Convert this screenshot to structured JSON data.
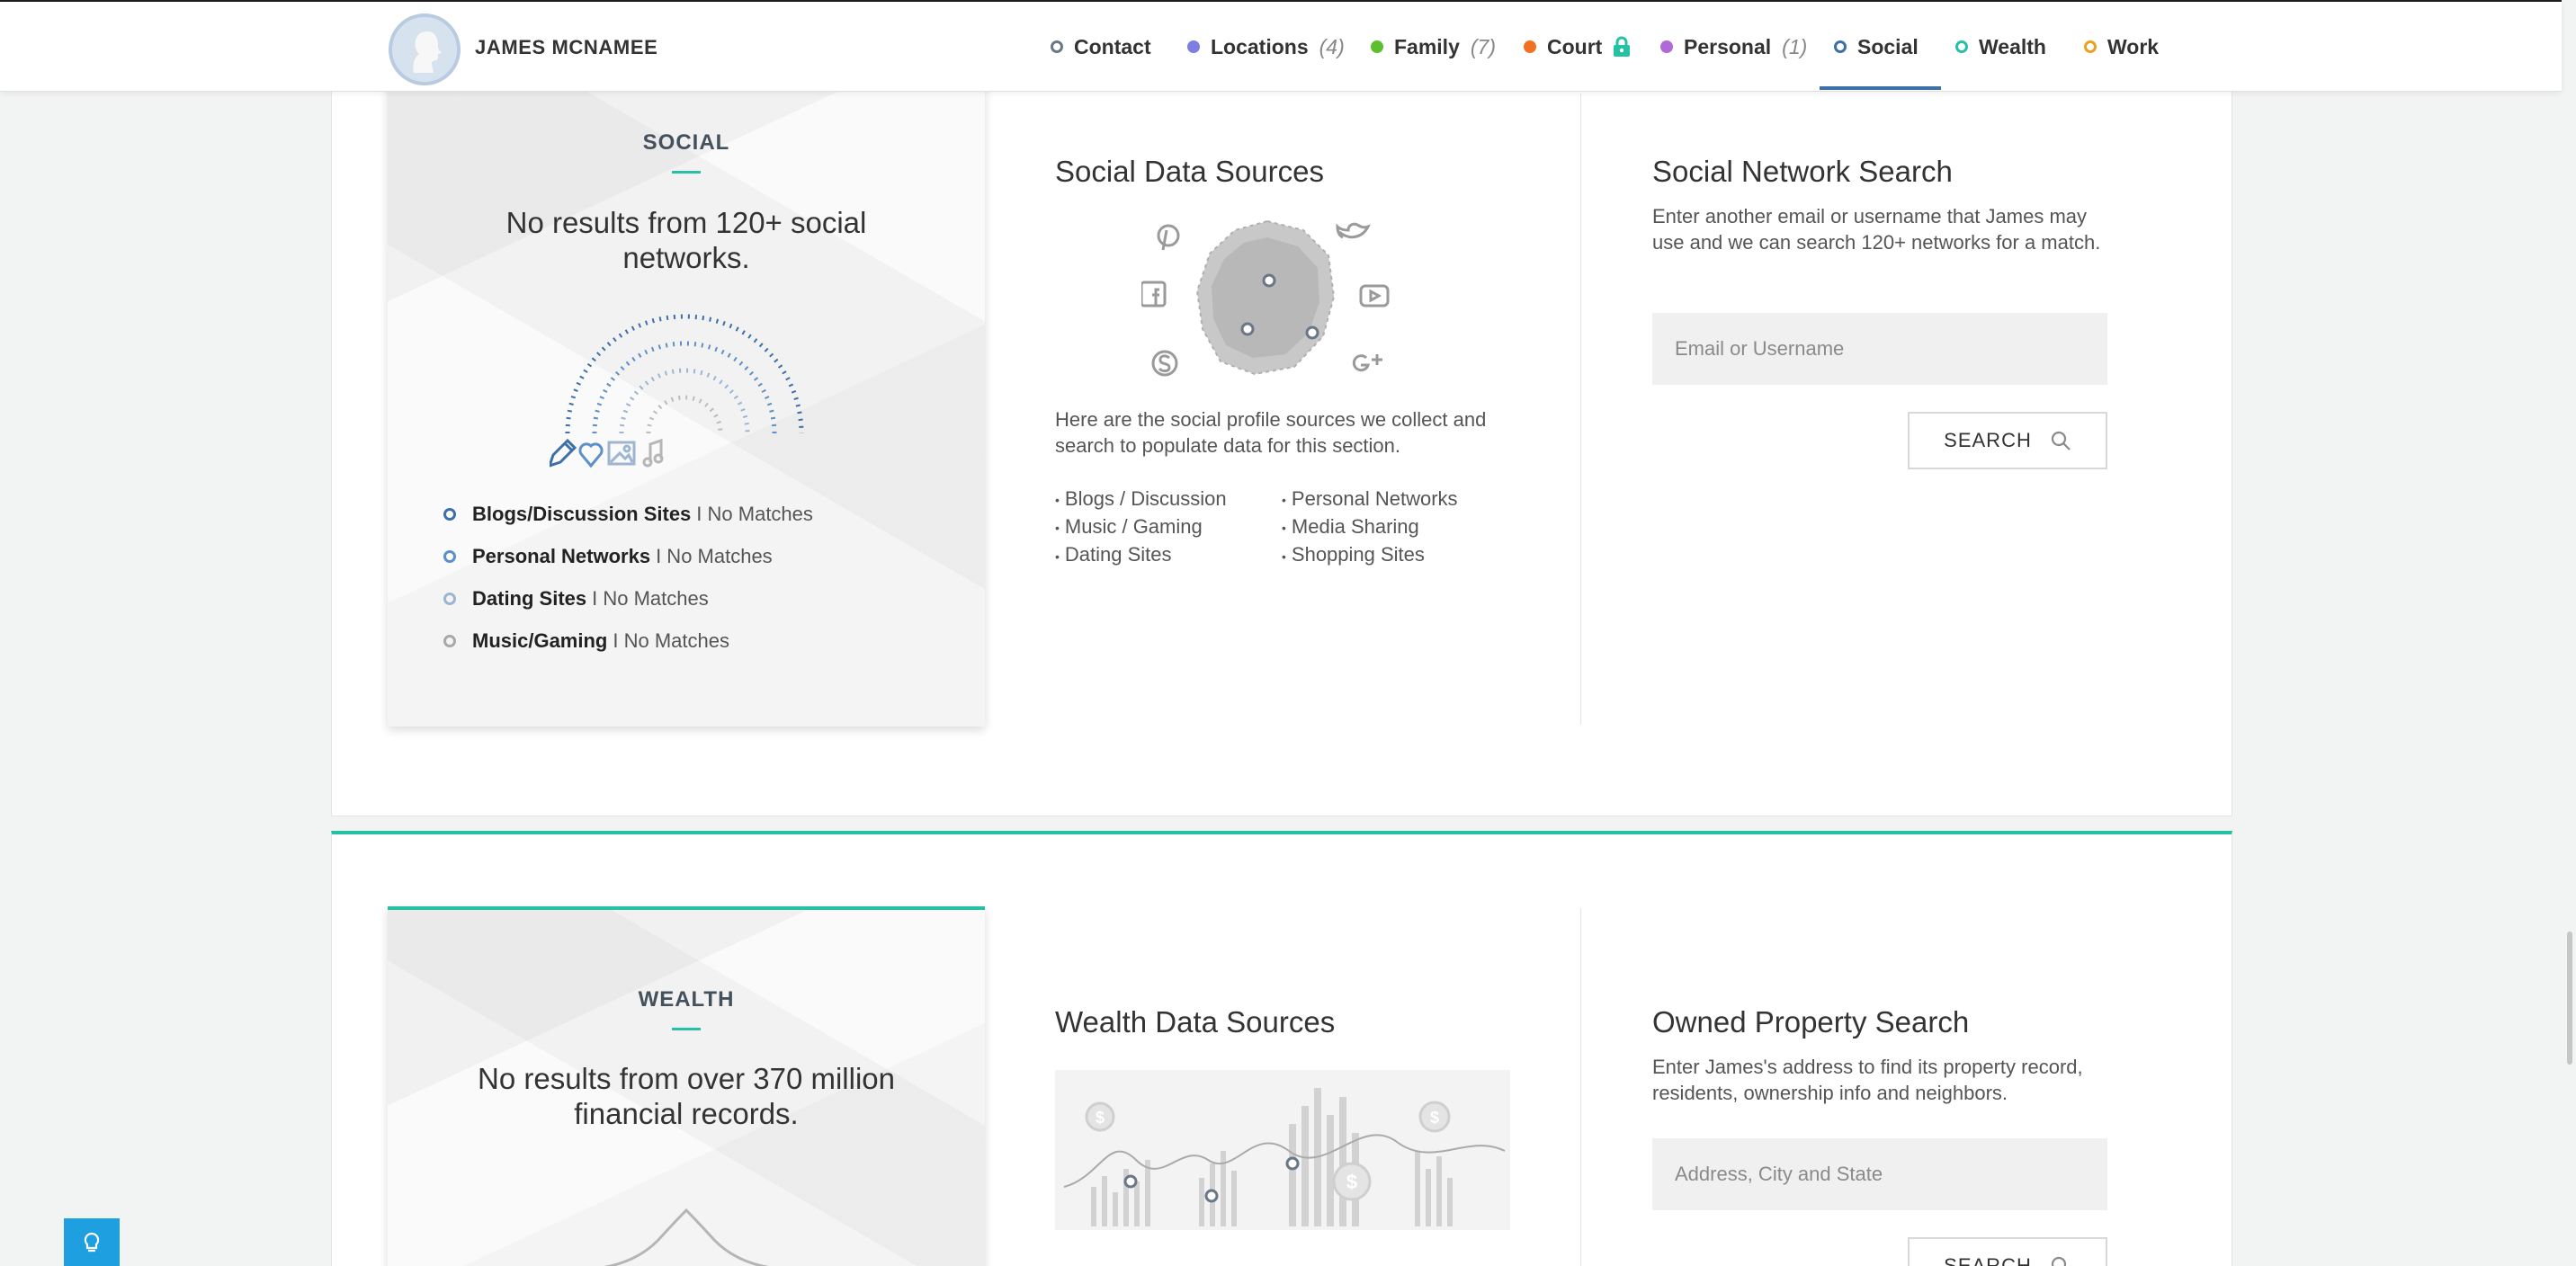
{
  "header": {
    "person_name": "JAMES MCNAMEE",
    "nav": [
      {
        "label": "Contact",
        "count": "",
        "color": "#6b7785",
        "dot": "ring",
        "icon": ""
      },
      {
        "label": "Locations",
        "count": "(4)",
        "color": "#7d7fe0",
        "dot": "filled",
        "icon": ""
      },
      {
        "label": "Family",
        "count": "(7)",
        "color": "#5bbf2e",
        "dot": "filled",
        "icon": ""
      },
      {
        "label": "Court",
        "count": "",
        "color": "#f07220",
        "dot": "filled",
        "icon": "lock-icon"
      },
      {
        "label": "Personal",
        "count": "(1)",
        "color": "#b069d9",
        "dot": "filled",
        "icon": ""
      },
      {
        "label": "Social",
        "count": "",
        "color": "#3d6fa8",
        "dot": "ring",
        "icon": ""
      },
      {
        "label": "Wealth",
        "count": "",
        "color": "#26c0a5",
        "dot": "ring",
        "icon": ""
      },
      {
        "label": "Work",
        "count": "",
        "color": "#f0a020",
        "dot": "ring",
        "icon": ""
      }
    ],
    "active_tab": "Social"
  },
  "social": {
    "card": {
      "heading": "SOCIAL",
      "subtitle": "No results from 120+ social networks.",
      "matches": [
        {
          "category": "Blogs/Discussion Sites",
          "status": " I No Matches",
          "ring_color": "#3d6fa8"
        },
        {
          "category": "Personal Networks",
          "status": "I No Matches",
          "ring_color": "#5d8fc8"
        },
        {
          "category": "Dating Sites",
          "status": "I No Matches",
          "ring_color": "#9db5d2"
        },
        {
          "category": "Music/Gaming",
          "status": "I No Matches",
          "ring_color": "#a8a8a8"
        }
      ]
    },
    "sources": {
      "title": "Social Data Sources",
      "description": "Here are the social profile sources we collect and search to populate data for this section.",
      "items": [
        "Blogs / Discussion",
        "Personal Networks",
        "Music / Gaming",
        "Media Sharing",
        "Dating Sites",
        "Shopping Sites"
      ]
    },
    "search": {
      "title": "Social Network Search",
      "description": "Enter another email or username that James may use and we can search 120+ networks for a match.",
      "placeholder": "Email or Username",
      "button_label": "SEARCH"
    }
  },
  "wealth": {
    "card": {
      "heading": "WEALTH",
      "subtitle": "No results from over 370 million financial records."
    },
    "sources": {
      "title": "Wealth Data Sources"
    },
    "search": {
      "title": "Owned Property Search",
      "description": "Enter James's address to find its property record, residents, ownership info and neighbors.",
      "placeholder": "Address, City and State",
      "button_label": "SEARCH"
    }
  },
  "colors": {
    "social_accent": "#3d6fa8",
    "wealth_accent": "#26c0a5",
    "tip_button": "#1e9fe0"
  }
}
